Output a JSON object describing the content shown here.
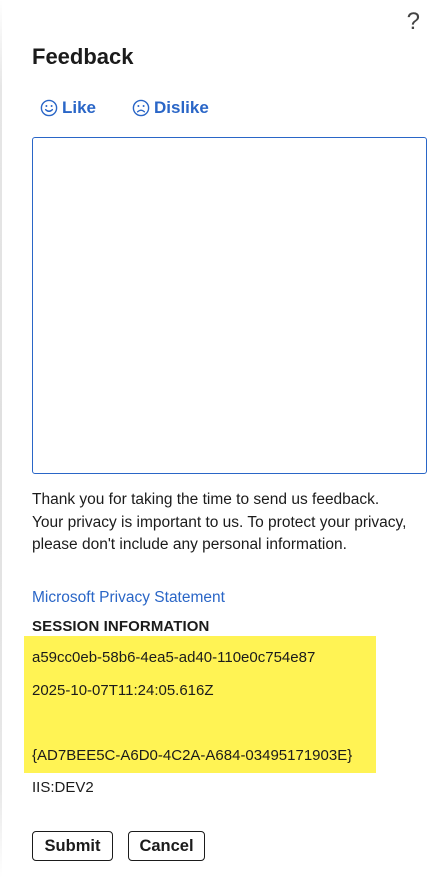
{
  "dialog": {
    "help_label": "?",
    "title": "Feedback"
  },
  "reactions": {
    "like_label": "Like",
    "dislike_label": "Dislike"
  },
  "feedback_input": {
    "value": "",
    "placeholder": ""
  },
  "privacy": {
    "text": "Thank you for taking the time to send us feedback. Your privacy is important to us. To protect your privacy, please don't include any personal information.",
    "link_label": "Microsoft Privacy Statement"
  },
  "session": {
    "heading": "SESSION INFORMATION",
    "session_id": "a59cc0eb-58b6-4ea5-ad40-110e0c754e87",
    "timestamp": "2025-10-07T11:24:05.616Z",
    "guid": "{AD7BEE5C-A6D0-4C2A-A684-03495171903E}",
    "server": "IIS:DEV2"
  },
  "actions": {
    "submit_label": "Submit",
    "cancel_label": "Cancel"
  },
  "colors": {
    "accent": "#2a66c7",
    "highlight": "#fff354",
    "text": "#1b1b1b"
  }
}
